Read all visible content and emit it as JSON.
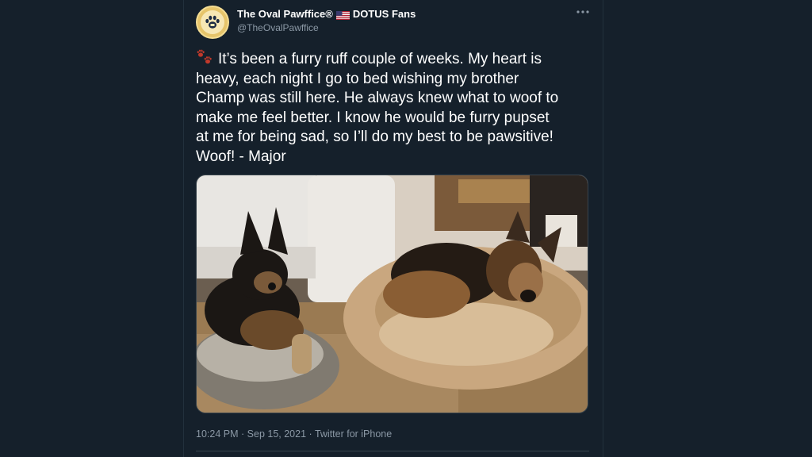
{
  "author": {
    "display_name": "The Oval Pawffice®",
    "display_name_suffix": "DOTUS Fans",
    "handle": "@TheOvalPawffice",
    "avatar_icon": "paw-print-icon",
    "flag_icon": "us-flag-icon"
  },
  "tweet": {
    "lines": [
      "It’s been a furry ruff couple of weeks. My heart is",
      "heavy, each night I go to bed wishing my brother",
      "Champ was still here. He always knew what to woof to",
      "make me feel better. I know he would be furry pupset",
      "at me for being sad, so I’ll do my best to be pawsitive!",
      "Woof! - Major"
    ],
    "emoji_icon": "paw-prints-emoji",
    "photo_alt": "Two German Shepherd dogs lying on dog beds"
  },
  "meta": {
    "time": "10:24 PM",
    "date": "Sep 15, 2021",
    "source": "Twitter for iPhone",
    "separator": "·"
  },
  "more_icon": "more-options-icon",
  "colors": {
    "background": "#15202b",
    "text": "#ffffff",
    "secondary_text": "#8b98a5",
    "border": "#38444d"
  }
}
